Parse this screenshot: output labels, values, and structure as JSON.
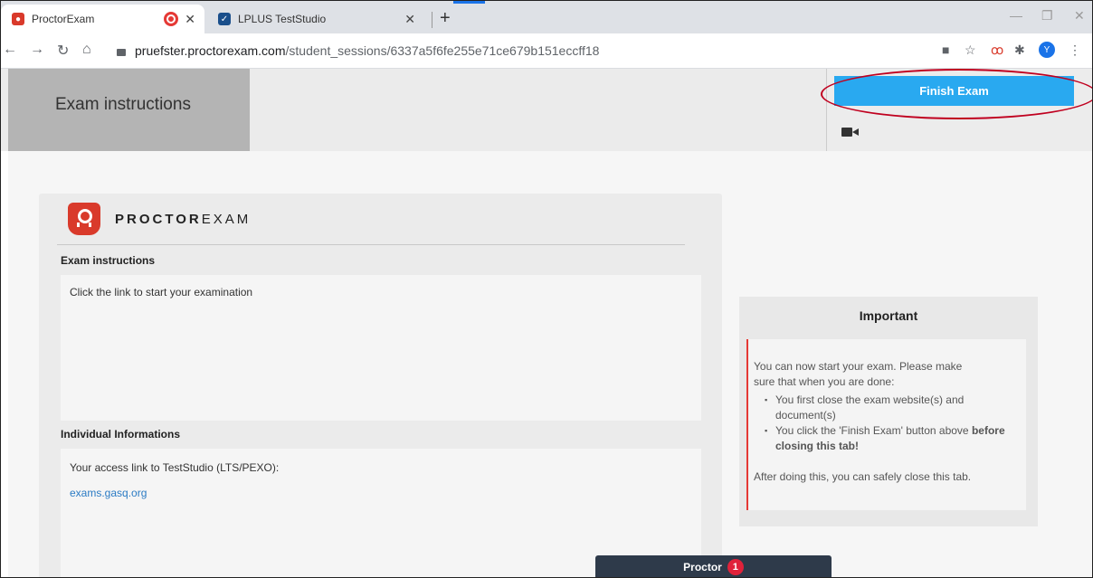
{
  "browser": {
    "tabs": [
      {
        "title": "ProctorExam",
        "favicon_color": "#d93a2b"
      },
      {
        "title": "LPLUS TestStudio",
        "favicon_color": "#1a4f8b"
      }
    ],
    "url_host": "pruefster.proctorexam.com",
    "url_path": "/student_sessions/6337a5f6fe255e71ce679b151eccff18",
    "avatar_initial": "Y"
  },
  "header": {
    "title": "Exam instructions",
    "finish_button": "Finish Exam"
  },
  "logo": {
    "bold": "PROCTOR",
    "light": "EXAM"
  },
  "instructions": {
    "heading": "Exam instructions",
    "text": "Click the link to start your examination"
  },
  "individual": {
    "heading": "Individual Informations",
    "text": "Your access link to TestStudio (LTS/PEXO):",
    "link": "exams.gasq.org"
  },
  "important": {
    "title": "Important",
    "intro_1": "You can now start your exam. Please make",
    "intro_2": "sure that when you are done:",
    "item_1": "You first close the exam website(s) and document(s)",
    "item_2_prefix": "You click the 'Finish Exam' button above",
    "item_2_bold": "before closing this tab!",
    "outro": "After doing this, you can safely close this tab."
  },
  "proctor": {
    "label": "Proctor",
    "count": "1"
  },
  "colors": {
    "finish_button": "#29a9f0",
    "accent_red": "#e53935",
    "proctor_bar": "#2e3a4a"
  }
}
